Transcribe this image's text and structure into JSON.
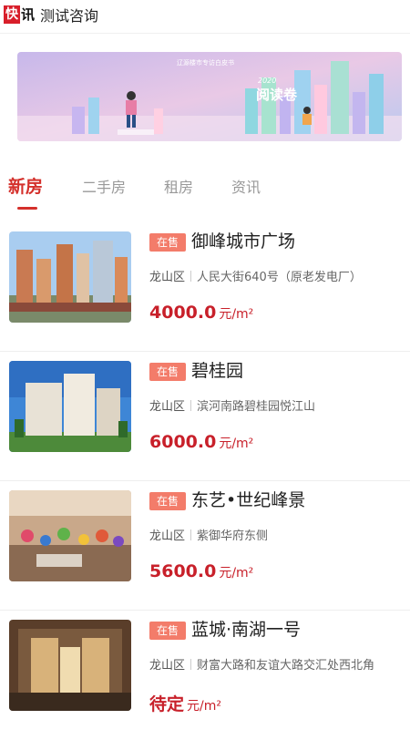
{
  "header": {
    "logo_part1": "快",
    "logo_part2": "讯",
    "title": "测试咨询"
  },
  "banner": {
    "caption": "辽源楼市专访白皮书",
    "tag": "2020",
    "sub": "阅读卷"
  },
  "tabs": [
    {
      "label": "新房",
      "active": true
    },
    {
      "label": "二手房",
      "active": false
    },
    {
      "label": "租房",
      "active": false
    },
    {
      "label": "资讯",
      "active": false
    }
  ],
  "listings": [
    {
      "badge": "在售",
      "name": "御峰城市广场",
      "district": "龙山区",
      "address": "人民大街640号（原老发电厂）",
      "price": "4000.0",
      "unit": "元/m²"
    },
    {
      "badge": "在售",
      "name": "碧桂园",
      "district": "龙山区",
      "address": "滨河南路碧桂园悦江山",
      "price": "6000.0",
      "unit": "元/m²"
    },
    {
      "badge": "在售",
      "name": "东艺•世纪峰景",
      "district": "龙山区",
      "address": "紫御华府东侧",
      "price": "5600.0",
      "unit": "元/m²"
    },
    {
      "badge": "在售",
      "name": "蓝城·南湖一号",
      "district": "龙山区",
      "address": "财富大路和友谊大路交汇处西北角",
      "price": "待定",
      "unit": "元/m²"
    }
  ],
  "colors": {
    "accent": "#d4302b",
    "badge": "#f37c6a",
    "price": "#c8202a"
  }
}
